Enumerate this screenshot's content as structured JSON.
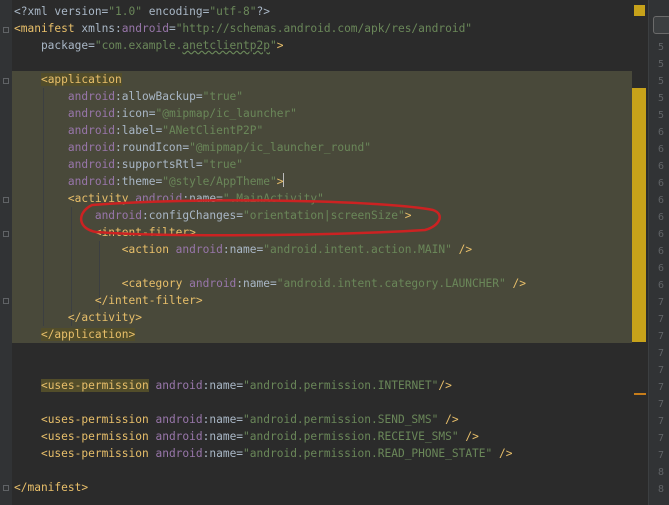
{
  "editor": {
    "lines": [
      {
        "parts": [
          {
            "t": "<?xml version=",
            "c": "pre"
          },
          {
            "t": "\"1.0\"",
            "c": "av"
          },
          {
            "t": " encoding=",
            "c": "pre"
          },
          {
            "t": "\"utf-8\"",
            "c": "av"
          },
          {
            "t": "?>",
            "c": "pre"
          }
        ]
      },
      {
        "parts": [
          {
            "t": "<manifest ",
            "c": "tag"
          },
          {
            "t": "xmlns:",
            "c": "pl"
          },
          {
            "t": "android",
            "c": "ns"
          },
          {
            "t": "=",
            "c": "pl"
          },
          {
            "t": "\"http://schemas.android.com/apk/res/android\"",
            "c": "av"
          }
        ]
      },
      {
        "parts": [
          {
            "t": "    package=",
            "c": "pl"
          },
          {
            "t": "\"com.example.",
            "c": "av"
          },
          {
            "t": "anetclientp2p",
            "c": "av underline"
          },
          {
            "t": "\"",
            "c": "av"
          },
          {
            "t": ">",
            "c": "tag"
          }
        ]
      },
      {
        "parts": []
      },
      {
        "parts": [
          {
            "t": "    ",
            "c": "pl"
          },
          {
            "t": "<application",
            "c": "tag tagbg"
          }
        ]
      },
      {
        "parts": [
          {
            "t": "        ",
            "c": "pl"
          },
          {
            "t": "android",
            "c": "ns"
          },
          {
            "t": ":allowBackup=",
            "c": "pl"
          },
          {
            "t": "\"true\"",
            "c": "av"
          }
        ]
      },
      {
        "parts": [
          {
            "t": "        ",
            "c": "pl"
          },
          {
            "t": "android",
            "c": "ns"
          },
          {
            "t": ":icon=",
            "c": "pl"
          },
          {
            "t": "\"@mipmap/ic_launcher\"",
            "c": "av"
          }
        ]
      },
      {
        "parts": [
          {
            "t": "        ",
            "c": "pl"
          },
          {
            "t": "android",
            "c": "ns"
          },
          {
            "t": ":label=",
            "c": "pl"
          },
          {
            "t": "\"ANetClientP2P\"",
            "c": "av"
          }
        ]
      },
      {
        "parts": [
          {
            "t": "        ",
            "c": "pl"
          },
          {
            "t": "android",
            "c": "ns"
          },
          {
            "t": ":roundIcon=",
            "c": "pl"
          },
          {
            "t": "\"@mipmap/ic_launcher_round\"",
            "c": "av"
          }
        ]
      },
      {
        "parts": [
          {
            "t": "        ",
            "c": "pl"
          },
          {
            "t": "android",
            "c": "ns"
          },
          {
            "t": ":supportsRtl=",
            "c": "pl"
          },
          {
            "t": "\"true\"",
            "c": "av"
          }
        ]
      },
      {
        "parts": [
          {
            "t": "        ",
            "c": "pl"
          },
          {
            "t": "android",
            "c": "ns"
          },
          {
            "t": ":theme=",
            "c": "pl"
          },
          {
            "t": "\"@style/AppTheme\"",
            "c": "av"
          },
          {
            "t": ">",
            "c": "tag"
          }
        ],
        "cursor": true
      },
      {
        "parts": [
          {
            "t": "        ",
            "c": "pl"
          },
          {
            "t": "<activity ",
            "c": "tag"
          },
          {
            "t": "android",
            "c": "ns"
          },
          {
            "t": ":name=",
            "c": "pl"
          },
          {
            "t": "\".MainActivity\"",
            "c": "av"
          }
        ]
      },
      {
        "parts": [
          {
            "t": "            ",
            "c": "pl"
          },
          {
            "t": "android",
            "c": "ns"
          },
          {
            "t": ":configChanges=",
            "c": "pl"
          },
          {
            "t": "\"orientation|screenSize\"",
            "c": "av"
          },
          {
            "t": ">",
            "c": "tag"
          }
        ]
      },
      {
        "parts": [
          {
            "t": "            ",
            "c": "pl"
          },
          {
            "t": "<intent-filter>",
            "c": "tag"
          }
        ]
      },
      {
        "parts": [
          {
            "t": "                ",
            "c": "pl"
          },
          {
            "t": "<action ",
            "c": "tag"
          },
          {
            "t": "android",
            "c": "ns"
          },
          {
            "t": ":name=",
            "c": "pl"
          },
          {
            "t": "\"android.intent.action.MAIN\"",
            "c": "av"
          },
          {
            "t": " />",
            "c": "tag"
          }
        ]
      },
      {
        "parts": []
      },
      {
        "parts": [
          {
            "t": "                ",
            "c": "pl"
          },
          {
            "t": "<category ",
            "c": "tag"
          },
          {
            "t": "android",
            "c": "ns"
          },
          {
            "t": ":name=",
            "c": "pl"
          },
          {
            "t": "\"android.intent.category.LAUNCHER\"",
            "c": "av"
          },
          {
            "t": " />",
            "c": "tag"
          }
        ]
      },
      {
        "parts": [
          {
            "t": "            ",
            "c": "pl"
          },
          {
            "t": "</intent-filter>",
            "c": "tag"
          }
        ]
      },
      {
        "parts": [
          {
            "t": "        ",
            "c": "pl"
          },
          {
            "t": "</activity>",
            "c": "tag"
          }
        ]
      },
      {
        "parts": [
          {
            "t": "    ",
            "c": "pl"
          },
          {
            "t": "</application>",
            "c": "tag tagbg"
          }
        ]
      },
      {
        "parts": []
      },
      {
        "parts": []
      },
      {
        "parts": [
          {
            "t": "    ",
            "c": "pl"
          },
          {
            "t": "<uses-permission",
            "c": "tag tagbg"
          },
          {
            "t": " ",
            "c": "pl"
          },
          {
            "t": "android",
            "c": "ns"
          },
          {
            "t": ":name=",
            "c": "pl"
          },
          {
            "t": "\"android.permission.INTERNET\"",
            "c": "av"
          },
          {
            "t": "/>",
            "c": "tag"
          }
        ]
      },
      {
        "parts": []
      },
      {
        "parts": [
          {
            "t": "    ",
            "c": "pl"
          },
          {
            "t": "<uses-permission ",
            "c": "tag"
          },
          {
            "t": "android",
            "c": "ns"
          },
          {
            "t": ":name=",
            "c": "pl"
          },
          {
            "t": "\"android.permission.SEND_SMS\"",
            "c": "av"
          },
          {
            "t": " />",
            "c": "tag"
          }
        ]
      },
      {
        "parts": [
          {
            "t": "    ",
            "c": "pl"
          },
          {
            "t": "<uses-permission ",
            "c": "tag"
          },
          {
            "t": "android",
            "c": "ns"
          },
          {
            "t": ":name=",
            "c": "pl"
          },
          {
            "t": "\"android.permission.RECEIVE_SMS\"",
            "c": "av"
          },
          {
            "t": " />",
            "c": "tag"
          }
        ]
      },
      {
        "parts": [
          {
            "t": "    ",
            "c": "pl"
          },
          {
            "t": "<uses-permission ",
            "c": "tag"
          },
          {
            "t": "android",
            "c": "ns"
          },
          {
            "t": ":name=",
            "c": "pl"
          },
          {
            "t": "\"android.permission.READ_PHONE_STATE\"",
            "c": "av"
          },
          {
            "t": " />",
            "c": "tag"
          }
        ]
      },
      {
        "parts": []
      },
      {
        "parts": [
          {
            "t": "</manifest>",
            "c": "tag"
          }
        ]
      }
    ]
  },
  "right_panel": {
    "line_numbers": [
      "5",
      "5",
      "5",
      "5",
      "5",
      "6",
      "6",
      "6",
      "6",
      "6",
      "6",
      "6",
      "6",
      "6",
      "6",
      "7",
      "7",
      "7",
      "7",
      "7",
      "7",
      "7",
      "7",
      "7",
      "7",
      "8",
      "8"
    ]
  },
  "colors": {
    "background": "#2b2b2b",
    "selection_highlight": "#49493a",
    "annotation_red": "#cc2222"
  }
}
